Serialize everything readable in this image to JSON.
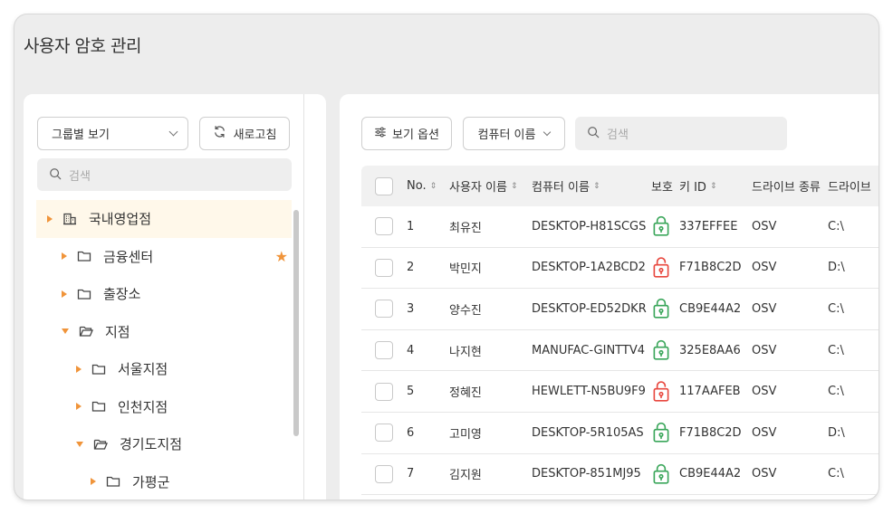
{
  "page": {
    "title": "사용자 암호 관리"
  },
  "left": {
    "group_select": {
      "value": "그룹별 보기"
    },
    "refresh_label": "새로고침",
    "search_placeholder": "검색",
    "tree": [
      {
        "label": "국내영업점",
        "level": 0,
        "state": "collapsed",
        "icon": "building-icon",
        "active": true,
        "starred": false
      },
      {
        "label": "금융센터",
        "level": 1,
        "state": "collapsed",
        "icon": "folder-icon",
        "active": false,
        "starred": true
      },
      {
        "label": "출장소",
        "level": 1,
        "state": "collapsed",
        "icon": "folder-icon",
        "active": false,
        "starred": false
      },
      {
        "label": "지점",
        "level": 1,
        "state": "expanded",
        "icon": "folder-open-icon",
        "active": false,
        "starred": false
      },
      {
        "label": "서울지점",
        "level": 2,
        "state": "collapsed",
        "icon": "folder-icon",
        "active": false,
        "starred": false
      },
      {
        "label": "인천지점",
        "level": 2,
        "state": "collapsed",
        "icon": "folder-icon",
        "active": false,
        "starred": false
      },
      {
        "label": "경기도지점",
        "level": 2,
        "state": "expanded",
        "icon": "folder-open-icon",
        "active": false,
        "starred": false
      },
      {
        "label": "가평군",
        "level": 3,
        "state": "collapsed",
        "icon": "folder-icon",
        "active": false,
        "starred": false
      }
    ]
  },
  "right": {
    "view_options_label": "보기 옵션",
    "computer_select_value": "컴퓨터 이름",
    "search_placeholder": "검색",
    "columns": {
      "no": "No.",
      "user": "사용자 이름",
      "computer": "컴퓨터 이름",
      "protection": "보호",
      "key_id": "키 ID",
      "drive_type": "드라이브 종류",
      "drive": "드라이브"
    },
    "rows": [
      {
        "no": "1",
        "user": "최유진",
        "computer": "DESKTOP-H81SCGS",
        "protected": true,
        "key_id": "337EFFEE",
        "drive_type": "OSV",
        "drive": "C:\\"
      },
      {
        "no": "2",
        "user": "박민지",
        "computer": "DESKTOP-1A2BCD2",
        "protected": false,
        "key_id": "F71B8C2D",
        "drive_type": "OSV",
        "drive": "D:\\"
      },
      {
        "no": "3",
        "user": "양수진",
        "computer": "DESKTOP-ED52DKR",
        "protected": true,
        "key_id": "CB9E44A2",
        "drive_type": "OSV",
        "drive": "C:\\"
      },
      {
        "no": "4",
        "user": "나지현",
        "computer": "MANUFAC-GINTTV4",
        "protected": true,
        "key_id": "325E8AA6",
        "drive_type": "OSV",
        "drive": "C:\\"
      },
      {
        "no": "5",
        "user": "정혜진",
        "computer": "HEWLETT-N5BU9F9",
        "protected": false,
        "key_id": "117AAFEB",
        "drive_type": "OSV",
        "drive": "C:\\"
      },
      {
        "no": "6",
        "user": "고미영",
        "computer": "DESKTOP-5R105AS",
        "protected": true,
        "key_id": "F71B8C2D",
        "drive_type": "OSV",
        "drive": "D:\\"
      },
      {
        "no": "7",
        "user": "김지원",
        "computer": "DESKTOP-851MJ95",
        "protected": true,
        "key_id": "CB9E44A2",
        "drive_type": "OSV",
        "drive": "C:\\"
      }
    ]
  },
  "colors": {
    "accent": "#f0943a",
    "lock_locked": "#3aa65a",
    "lock_unlocked": "#e8483f",
    "active_row": "#fff8ea"
  }
}
